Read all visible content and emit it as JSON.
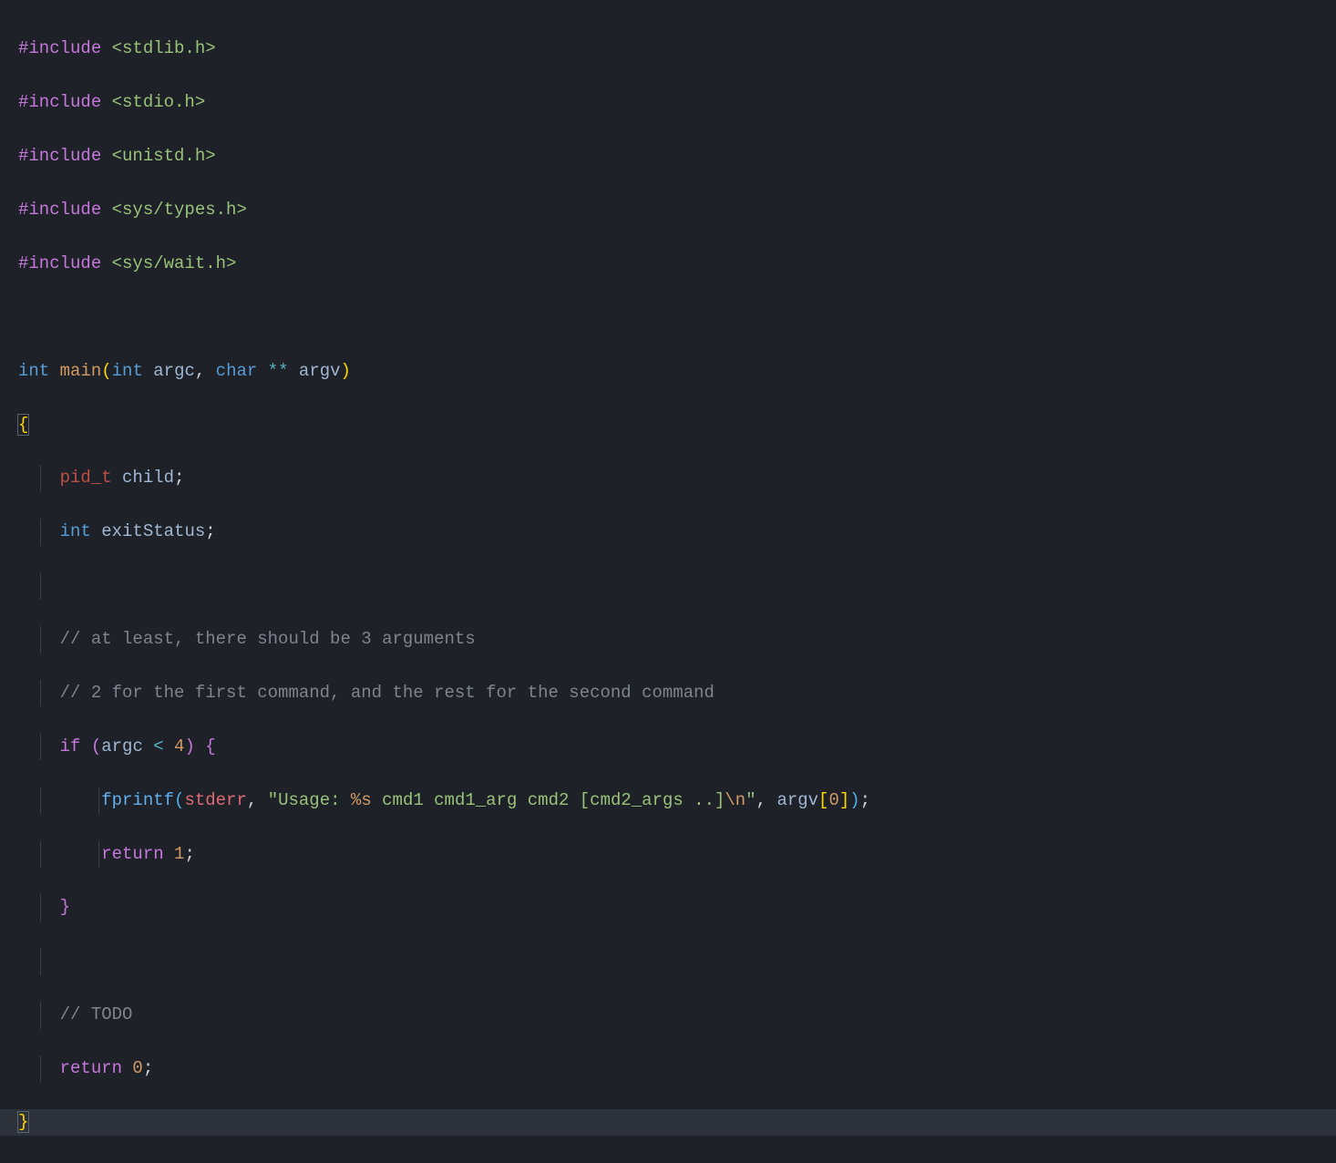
{
  "code": {
    "line1": {
      "include": "#include",
      "header": " <stdlib.h>"
    },
    "line2": {
      "include": "#include",
      "header": " <stdio.h>"
    },
    "line3": {
      "include": "#include",
      "header": " <unistd.h>"
    },
    "line4": {
      "include": "#include",
      "header": " <sys/types.h>"
    },
    "line5": {
      "include": "#include",
      "header": " <sys/wait.h>"
    },
    "line7": {
      "int": "int",
      "main": " main",
      "open": "(",
      "int2": "int",
      "argc": " argc",
      "comma": ",",
      "char": " char",
      "stars": " **",
      "argv": " argv",
      "close": ")"
    },
    "line8": "{",
    "line9": {
      "indent": "    ",
      "pid_t": "pid_t",
      "child": " child",
      "semi": ";"
    },
    "line10": {
      "indent": "    ",
      "int": "int",
      "exitStatus": " exitStatus",
      "semi": ";"
    },
    "line12": {
      "indent": "    ",
      "comment": "// at least, there should be 3 arguments"
    },
    "line13": {
      "indent": "    ",
      "comment": "// 2 for the first command, and the rest for the second command"
    },
    "line14": {
      "indent": "    ",
      "if": "if",
      "sp": " ",
      "open": "(",
      "argc": "argc",
      "lt": " <",
      "four": " 4",
      "close": ")",
      "sp2": " ",
      "brace": "{"
    },
    "line15": {
      "indent": "        ",
      "fprintf": "fprintf",
      "open": "(",
      "stderr": "stderr",
      "comma": ",",
      "sp": " ",
      "q1": "\"",
      "str1": "Usage: ",
      "fmt": "%s",
      "str2": " cmd1 cmd1_arg cmd2 [cmd2_args ..]",
      "esc": "\\n",
      "q2": "\"",
      "comma2": ",",
      "sp2": " ",
      "argv": "argv",
      "bopen": "[",
      "zero": "0",
      "bclose": "]",
      "close": ")",
      "semi": ";"
    },
    "line16": {
      "indent": "        ",
      "return": "return",
      "one": " 1",
      "semi": ";"
    },
    "line17": {
      "indent": "    ",
      "brace": "}"
    },
    "line19": {
      "indent": "    ",
      "comment": "// TODO"
    },
    "line20": {
      "indent": "    ",
      "return": "return",
      "zero": " 0",
      "semi": ";"
    },
    "line21": "}"
  }
}
